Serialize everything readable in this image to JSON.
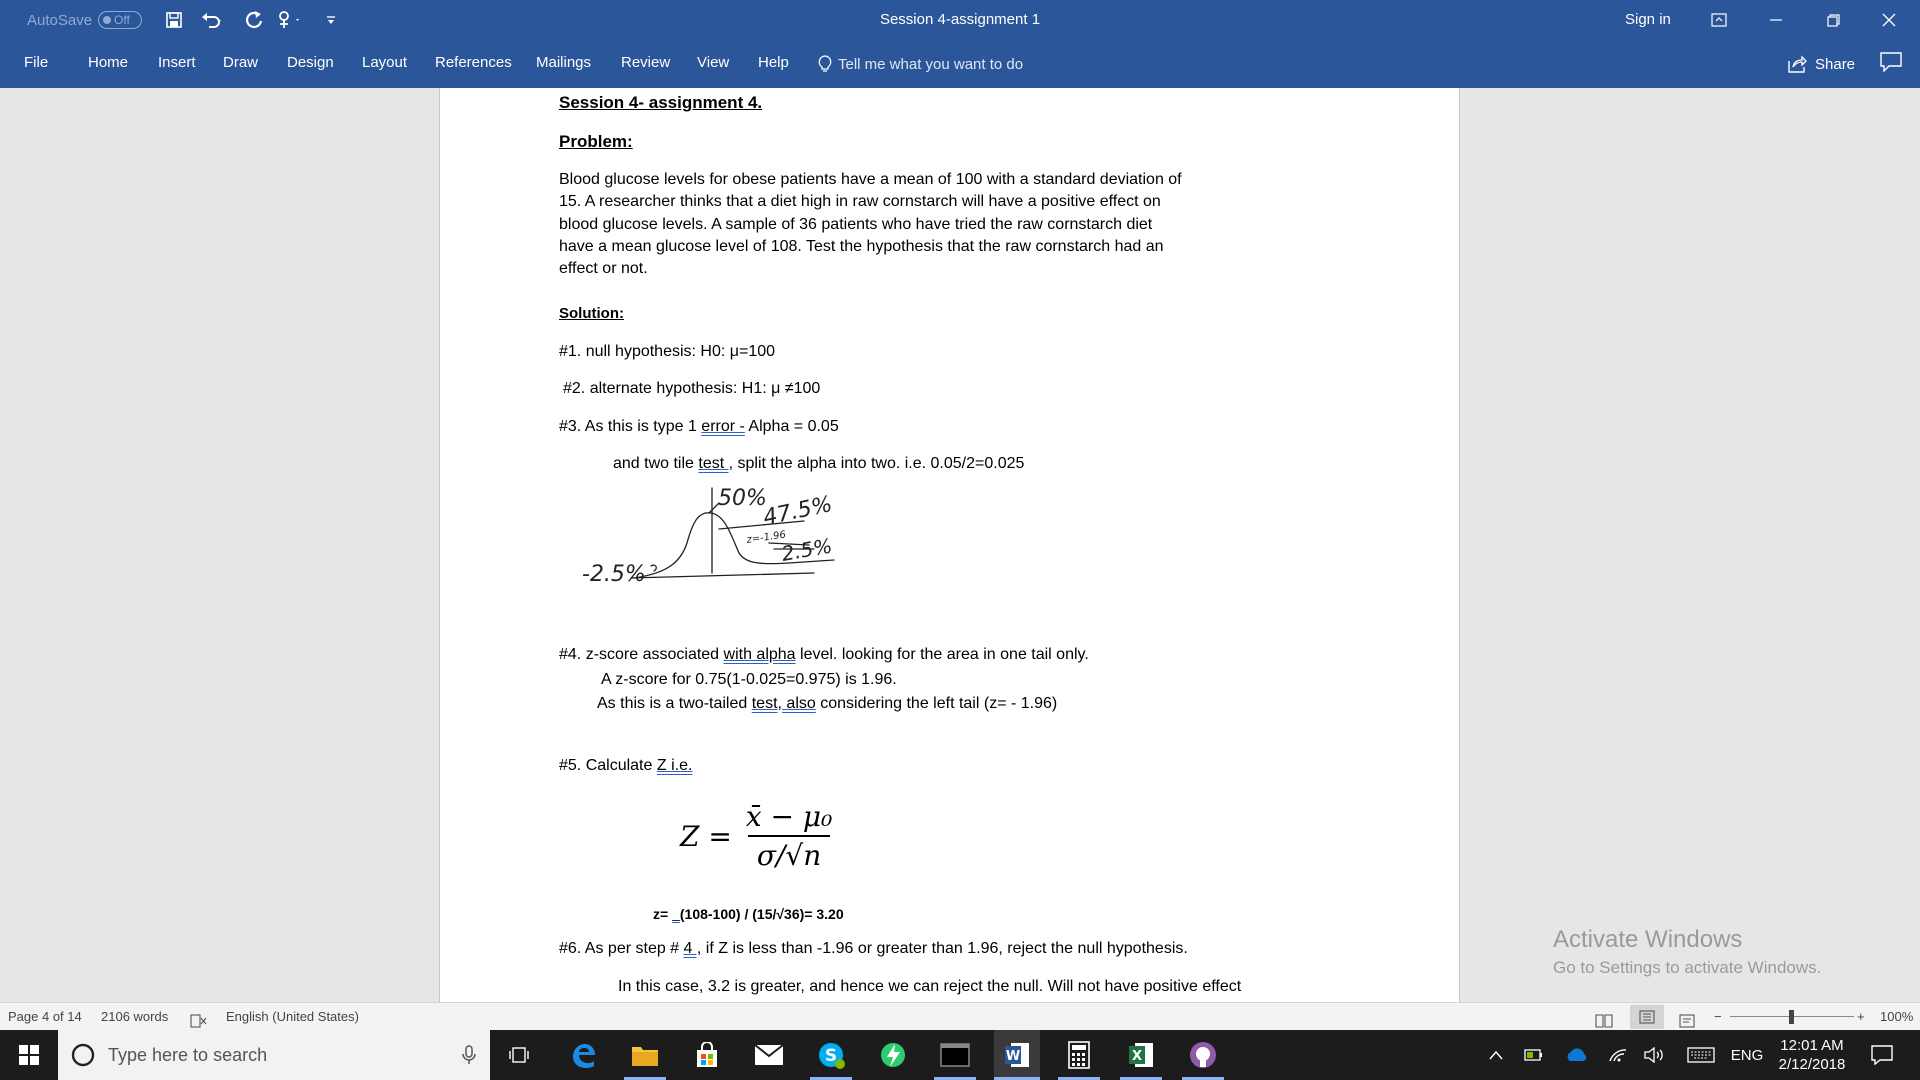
{
  "titlebar": {
    "autosave_label": "AutoSave",
    "autosave_state": "Off",
    "document_title": "Session 4-assignment 1",
    "signin": "Sign in"
  },
  "ribbon": {
    "tabs": [
      "File",
      "Home",
      "Insert",
      "Draw",
      "Design",
      "Layout",
      "References",
      "Mailings",
      "Review",
      "View",
      "Help"
    ],
    "tell_me": "Tell me what you want to do",
    "share": "Share"
  },
  "document": {
    "heading": "Session 4- assignment 4.",
    "problem_label": "Problem:",
    "problem_lines": [
      "Blood glucose levels for obese patients have a mean of 100 with a standard deviation of",
      "15. A researcher thinks that a diet high in raw cornstarch will have a positive effect on",
      "blood glucose levels. A sample of 36 patients who have tried the raw cornstarch diet",
      "have a mean glucose level of 108. Test the hypothesis that the raw cornstarch had an",
      "effect or not."
    ],
    "solution_label": "Solution:",
    "step1": "#1. null hypothesis: H0:  μ=100",
    "step2": "#2. alternate hypothesis: H1:   μ ≠100",
    "step3_a": "#3.  As this is type 1 ",
    "step3_b": "error  -",
    "step3_c": "  Alpha = 0.05",
    "step3_line2_a": "and two tile ",
    "step3_line2_b": "test ,",
    "step3_line2_c": "  split the alpha into two.  i.e. 0.05/2=0.025",
    "sketch": {
      "label_50": "50%",
      "label_475": "47.5%",
      "label_25_left": "-2.5%",
      "label_25_right": "2.5%",
      "label_small": "z=-1.96"
    },
    "step4_a": "#4. z-score associated ",
    "step4_b": "with  alpha",
    "step4_c": " level.  looking for the area in one tail only.",
    "step4_line2": "A z-score for 0.75(1-0.025=0.975) is 1.96.",
    "step4_line3_a": "As this is a two-tailed ",
    "step4_line3_b": "test,  also",
    "step4_line3_c": " considering the left tail (z= - 1.96)",
    "step5_a": "#5.   Calculate ",
    "step5_b": "Z  i.e.",
    "formula": {
      "lhs": "Z =",
      "numerator": "x̄ − μ₀",
      "denominator": "σ/√n"
    },
    "calc_a": "z=  ",
    "calc_b": "_",
    "calc_c": "(108-100) /  (15/√36)=  3.20",
    "step6_a": "#6.  As per step # ",
    "step6_b": "4 ,",
    "step6_c": " if Z is  less than -1.96 or greater than 1.96, reject the null hypothesis.",
    "conclusion": "In this case, 3.2 is greater, and hence we can reject the null. Will not have positive effect"
  },
  "watermark": {
    "line1": "Activate Windows",
    "line2": "Go to Settings to activate Windows."
  },
  "statusbar": {
    "page": "Page 4 of 14",
    "words": "2106 words",
    "language": "English (United States)",
    "zoom": "100%"
  },
  "taskbar": {
    "search_placeholder": "Type here to search",
    "language": "ENG",
    "time": "12:01 AM",
    "date": "2/12/2018"
  }
}
